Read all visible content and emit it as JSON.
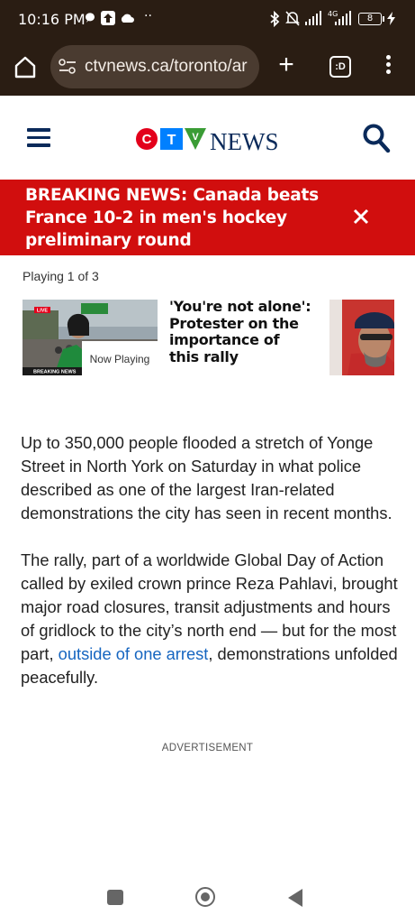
{
  "status_bar": {
    "time": "10:16 PM",
    "network_label": "4G",
    "battery_level": "8",
    "icons": [
      "chat-bubble-icon",
      "upload-icon",
      "cloud-icon",
      "more-dots-icon",
      "bluetooth-icon",
      "silent-bell-icon",
      "signal-icon",
      "signal-4g-icon",
      "battery-icon",
      "charging-icon"
    ]
  },
  "browser": {
    "url": "ctvnews.ca/toronto/ar",
    "tab_count_label": ":D",
    "icons": [
      "home-icon",
      "tune-icon",
      "plus-icon",
      "tab-switcher-icon",
      "overflow-menu-icon"
    ]
  },
  "site_header": {
    "logo_wordmark": "NEWS",
    "logo_letters": [
      "C",
      "T",
      "V"
    ],
    "brand_colors": {
      "red": "#e3001b",
      "blue": "#0080ff",
      "green": "#3a9c35",
      "navy": "#0a2a5a"
    },
    "icons": [
      "hamburger-menu-icon",
      "search-icon"
    ]
  },
  "breaking_news": {
    "text": "BREAKING NEWS: Canada beats France 10-2 in men's hockey preliminary round",
    "background": "#d10e0e",
    "icons": [
      "close-icon"
    ]
  },
  "playlist": {
    "counter": "Playing 1 of 3",
    "now_playing_label": "Now Playing",
    "thumb_badges": {
      "live": "LIVE",
      "breaking": "BREAKING NEWS"
    },
    "next_title": "'You're not alone': Protester on the importance of this rally"
  },
  "article": {
    "paragraph1": "Up to 350,000 people flooded a stretch of Yonge Street in North York on Saturday in what police described as one of the largest Iran-related demonstrations the city has seen in recent months.",
    "paragraph2_before": "The rally, part of a worldwide Global Day of Action called by exiled crown prince Reza Pahlavi, brought major road closures, transit adjustments and hours of gridlock to the city’s north end — but for the most part, ",
    "paragraph2_link": "outside of one arrest",
    "paragraph2_after": ", demonstrations unfolded peacefully.",
    "link_color": "#1565c0"
  },
  "advertisement_label": "ADVERTISEMENT",
  "nav_bar": {
    "icons": [
      "recents-square-icon",
      "home-circle-icon",
      "back-triangle-icon"
    ]
  }
}
